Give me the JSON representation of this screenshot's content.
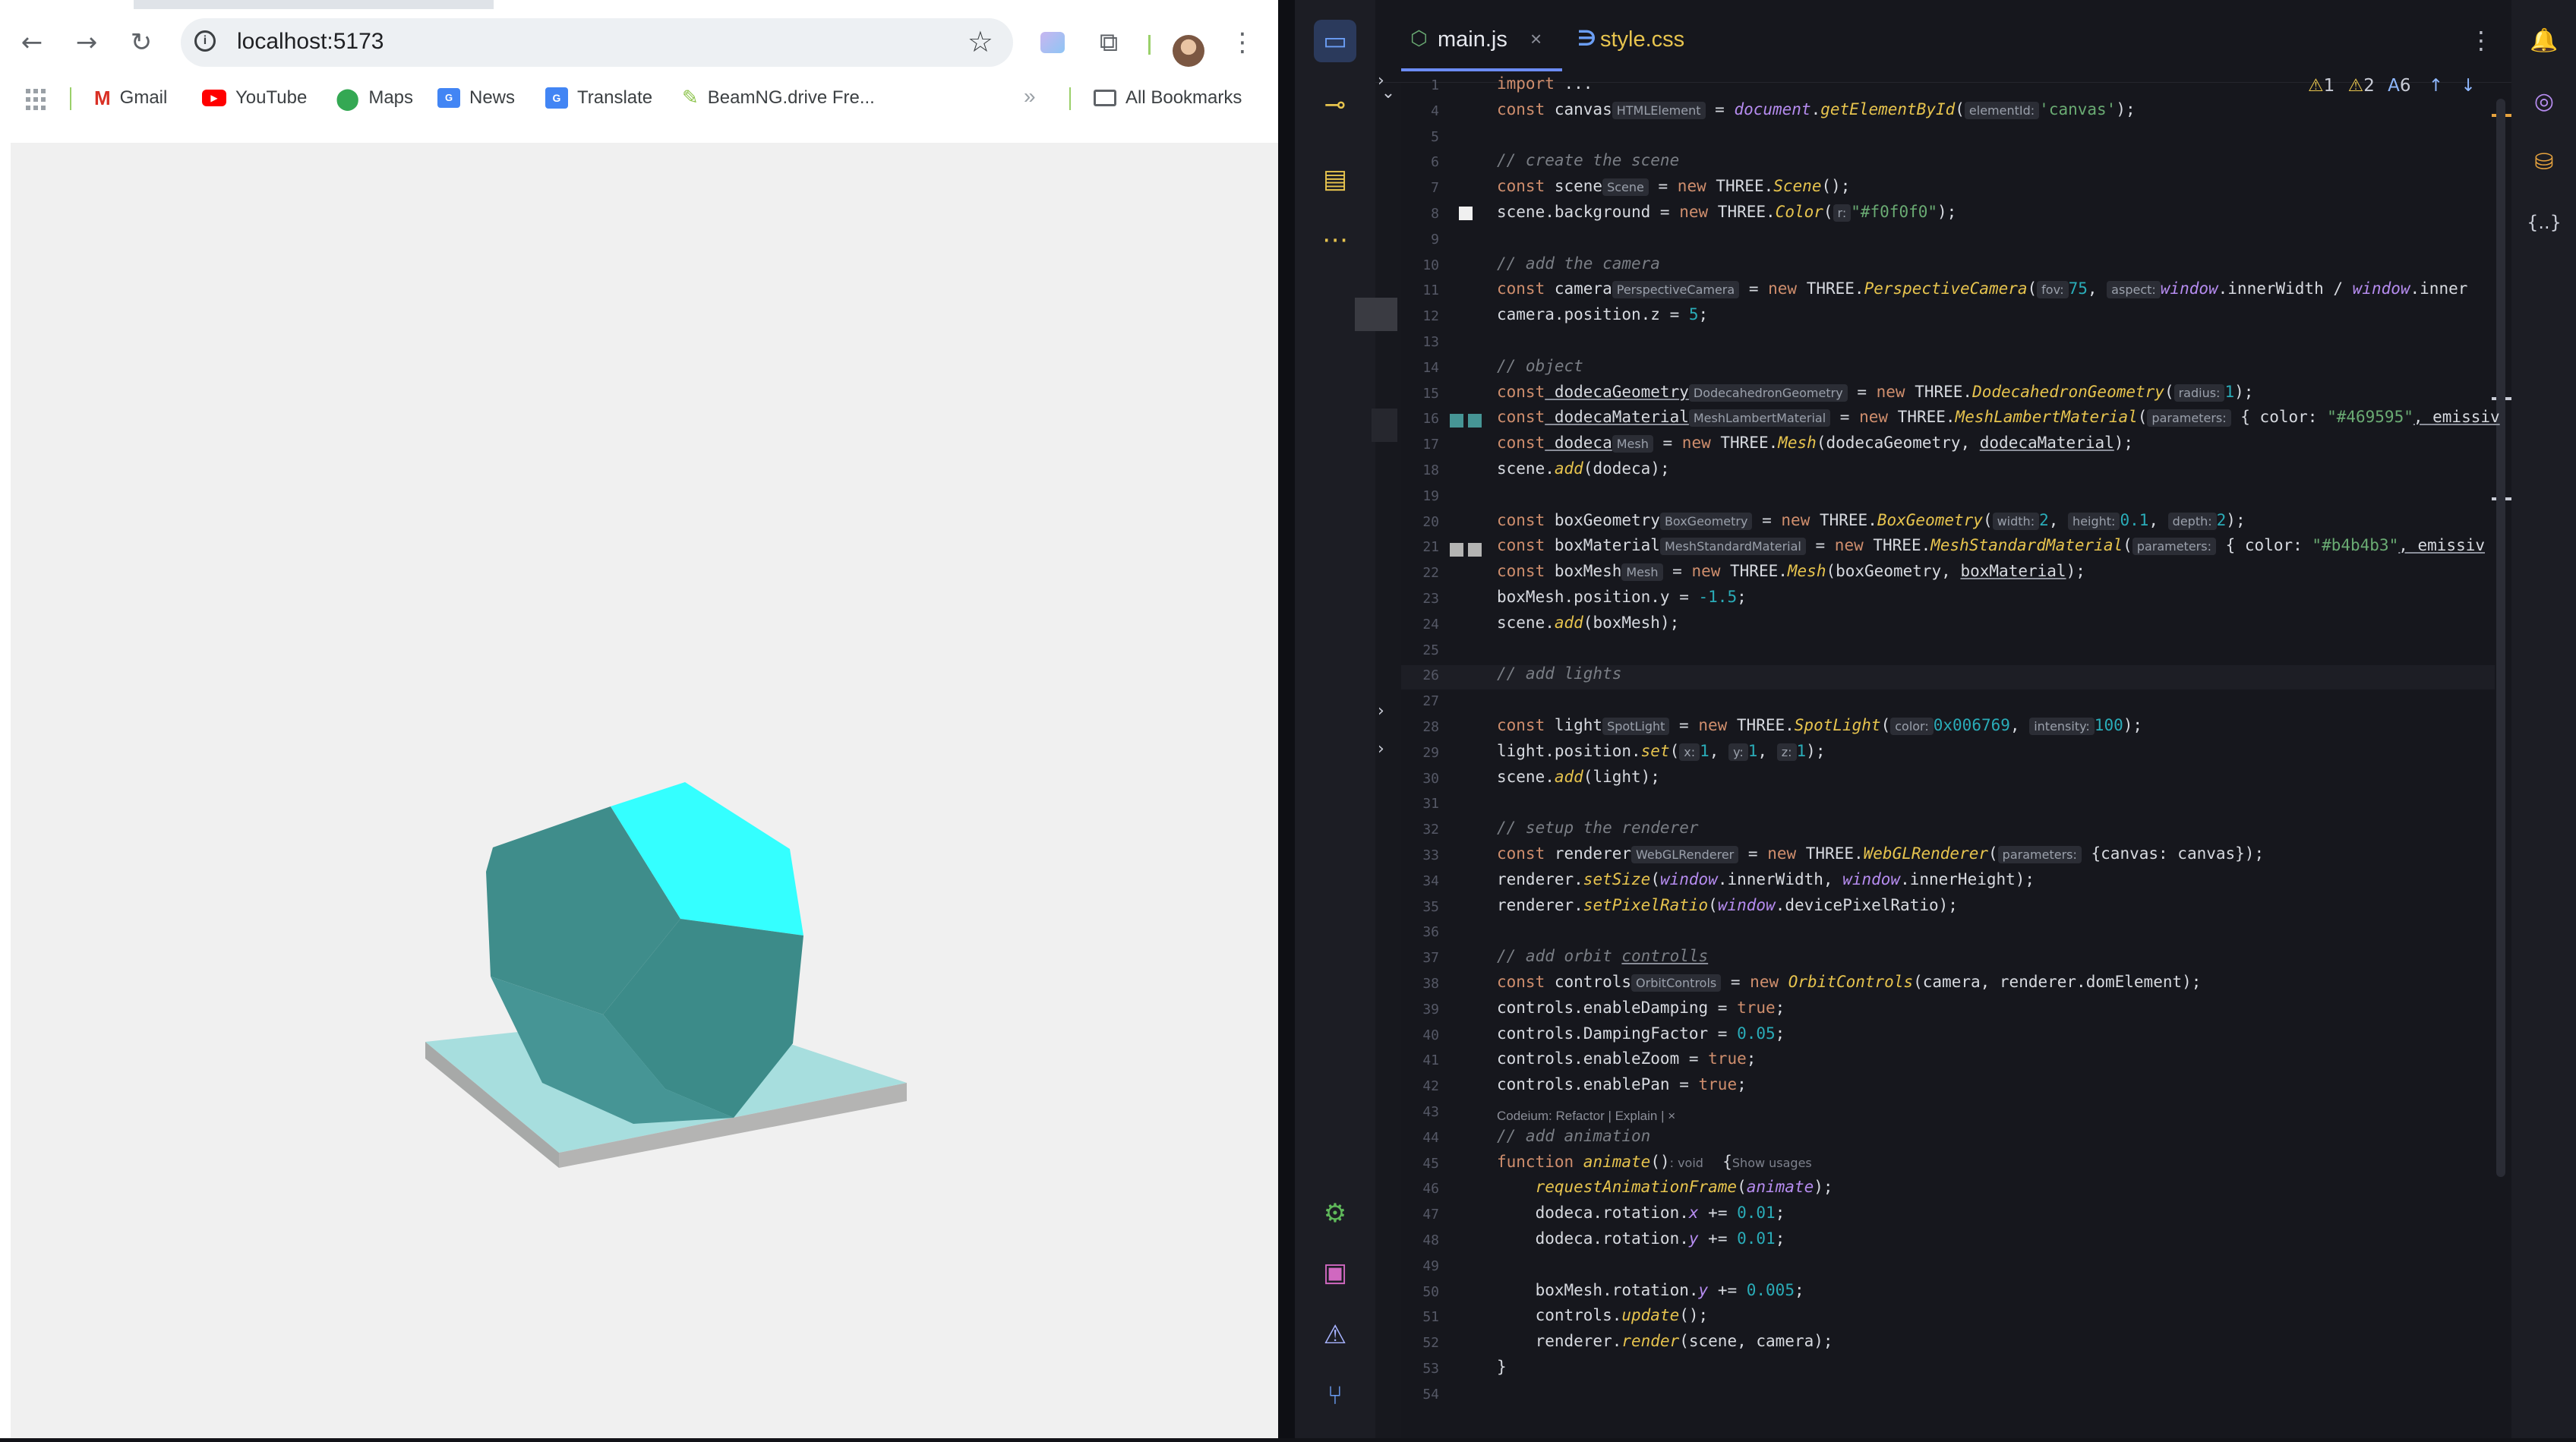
{
  "browser": {
    "url": "localhost:5173",
    "nav": {
      "back_icon": "back-arrow-icon",
      "forward_icon": "forward-arrow-icon",
      "reload_icon": "reload-icon"
    },
    "bookmarks": [
      {
        "label": "Gmail",
        "icon": "gmail-icon"
      },
      {
        "label": "YouTube",
        "icon": "youtube-icon"
      },
      {
        "label": "Maps",
        "icon": "maps-icon"
      },
      {
        "label": "News",
        "icon": "news-icon"
      },
      {
        "label": "Translate",
        "icon": "translate-icon"
      },
      {
        "label": "BeamNG.drive Fre...",
        "icon": "beamng-icon"
      }
    ],
    "all_bookmarks": "All Bookmarks",
    "more": "»",
    "scene": {
      "background": "#f0f0f0",
      "dodeca_color": "#469595",
      "box_color": "#b4b4b3"
    }
  },
  "ide": {
    "tabs": [
      {
        "label": "main.js",
        "active": true,
        "close": "×"
      },
      {
        "label": "style.css",
        "active": false
      }
    ],
    "inspections": {
      "warn1": "1",
      "warn2": "2",
      "typo": "6"
    },
    "codeium_lens": "Codeium: Refactor | Explain | ×",
    "lines": [
      {
        "n": "1"
      },
      {
        "n": "4"
      },
      {
        "n": "5"
      },
      {
        "n": "6"
      },
      {
        "n": "7"
      },
      {
        "n": "8"
      },
      {
        "n": "9"
      },
      {
        "n": "10"
      },
      {
        "n": "11"
      },
      {
        "n": "12"
      },
      {
        "n": "13"
      },
      {
        "n": "14"
      },
      {
        "n": "15"
      },
      {
        "n": "16"
      },
      {
        "n": "17"
      },
      {
        "n": "18"
      },
      {
        "n": "19"
      },
      {
        "n": "20"
      },
      {
        "n": "21"
      },
      {
        "n": "22"
      },
      {
        "n": "23"
      },
      {
        "n": "24"
      },
      {
        "n": "25"
      },
      {
        "n": "26"
      },
      {
        "n": "27"
      },
      {
        "n": "28"
      },
      {
        "n": "29"
      },
      {
        "n": "30"
      },
      {
        "n": "31"
      },
      {
        "n": "32"
      },
      {
        "n": "33"
      },
      {
        "n": "34"
      },
      {
        "n": "35"
      },
      {
        "n": "36"
      },
      {
        "n": "37"
      },
      {
        "n": "38"
      },
      {
        "n": "39"
      },
      {
        "n": "40"
      },
      {
        "n": "41"
      },
      {
        "n": "42"
      },
      {
        "n": "43"
      },
      {
        "n": "44"
      },
      {
        "n": "45"
      },
      {
        "n": "46"
      },
      {
        "n": "47"
      },
      {
        "n": "48"
      },
      {
        "n": "49"
      },
      {
        "n": "50"
      },
      {
        "n": "51"
      },
      {
        "n": "52"
      },
      {
        "n": "53"
      },
      {
        "n": "54"
      }
    ],
    "code": {
      "l1": {
        "kw": "import",
        "rest": " ..."
      },
      "l4": {
        "kw": "const",
        "v": " canvas",
        "hint": "HTMLElement",
        "eq": " = ",
        "obj": "document",
        "dot": ".",
        "fn": "getElementById",
        "op": "(",
        "ph": "elementId:",
        "str": "'canvas'",
        "end": ");"
      },
      "l6": "// create the scene",
      "l7": {
        "kw": "const",
        "v": " scene",
        "hint": "Scene",
        "eq": " = ",
        "kw2": "new",
        "cls": " THREE.",
        "fn": "Scene",
        "end": "();"
      },
      "l8": {
        "a": "scene.background = ",
        "kw2": "new",
        "cls": " THREE.",
        "fn": "Color",
        "op": "(",
        "ph": "r:",
        "str": "\"#f0f0f0\"",
        "end": ");"
      },
      "l10": "// add the camera",
      "l11": {
        "kw": "const",
        "v": " camera",
        "hint": "PerspectiveCamera",
        "eq": " = ",
        "kw2": "new",
        "cls": " THREE.",
        "fn": "PerspectiveCamera",
        "op": "(",
        "ph1": "fov:",
        "n1": "75",
        "c1": ", ",
        "ph2": "aspect:",
        "w1": "window",
        "r1": ".innerWidth / ",
        "w2": "window",
        "r2": ".inner"
      },
      "l12": {
        "a": "camera.position.z = ",
        "n": "5",
        "end": ";"
      },
      "l14": "// object",
      "l15": {
        "kw": "const",
        "v": " dodecaGeometry",
        "hint": "DodecahedronGeometry",
        "eq": " = ",
        "kw2": "new",
        "cls": " THREE.",
        "fn": "DodecahedronGeometry",
        "op": "(",
        "ph": "radius:",
        "n": "1",
        "end": ");"
      },
      "l16": {
        "kw": "const",
        "v": " dodecaMaterial",
        "hint": "MeshLambertMaterial",
        "eq": " = ",
        "kw2": "new",
        "cls": " THREE.",
        "fn": "MeshLambertMaterial",
        "op": "(",
        "ph": "parameters:",
        "r": " { color: ",
        "str": "\"#469595\"",
        "tail": ", emissiv"
      },
      "l17": {
        "kw": "const",
        "v": " dodeca",
        "hint": "Mesh",
        "eq": " = ",
        "kw2": "new",
        "cls": " THREE.",
        "fn": "Mesh",
        "r": "(dodecaGeometry, ",
        "u": "dodecaMaterial",
        "end": ");"
      },
      "l18": {
        "a": "scene.",
        "fn": "add",
        "end": "(dodeca);"
      },
      "l20": {
        "kw": "const",
        "v": " boxGeometry",
        "hint": "BoxGeometry",
        "eq": " = ",
        "kw2": "new",
        "cls": " THREE.",
        "fn": "BoxGeometry",
        "op": "(",
        "ph1": "width:",
        "n1": "2",
        "c1": ", ",
        "ph2": "height:",
        "n2": "0.1",
        "c2": ", ",
        "ph3": "depth:",
        "n3": "2",
        "end": ");"
      },
      "l21": {
        "kw": "const",
        "v": " boxMaterial",
        "hint": "MeshStandardMaterial",
        "eq": " = ",
        "kw2": "new",
        "cls": " THREE.",
        "fn": "MeshStandardMaterial",
        "op": "(",
        "ph": "parameters:",
        "r": " { color: ",
        "str": "\"#b4b4b3\"",
        "tail": ", emissiv"
      },
      "l22": {
        "kw": "const",
        "v": " boxMesh",
        "hint": "Mesh",
        "eq": " = ",
        "kw2": "new",
        "cls": " THREE.",
        "fn": "Mesh",
        "r": "(boxGeometry, ",
        "u": "boxMaterial",
        "end": ");"
      },
      "l23": {
        "a": "boxMesh.position.y = ",
        "n": "-1.5",
        "end": ";"
      },
      "l24": {
        "a": "scene.",
        "fn": "add",
        "end": "(boxMesh);"
      },
      "l26": "// add lights",
      "l28": {
        "kw": "const",
        "v": " light",
        "hint": "SpotLight",
        "eq": " = ",
        "kw2": "new",
        "cls": " THREE.",
        "fn": "SpotLight",
        "op": "(",
        "ph1": "color:",
        "n1": "0x006769",
        "c1": ", ",
        "ph2": "intensity:",
        "n2": "100",
        "end": ");"
      },
      "l29": {
        "a": "light.position.",
        "fn": "set",
        "op": "(",
        "ph1": "x:",
        "n1": "1",
        "c1": ", ",
        "ph2": "y:",
        "n2": "1",
        "c2": ", ",
        "ph3": "z:",
        "n3": "1",
        "end": ");"
      },
      "l30": {
        "a": "scene.",
        "fn": "add",
        "end": "(light);"
      },
      "l32": "// setup the renderer",
      "l33": {
        "kw": "const",
        "v": " renderer",
        "hint": "WebGLRenderer",
        "eq": " = ",
        "kw2": "new",
        "cls": " THREE.",
        "fn": "WebGLRenderer",
        "op": "(",
        "ph": "parameters:",
        "r": " {canvas: canvas});"
      },
      "l34": {
        "a": "renderer.",
        "fn": "setSize",
        "op": "(",
        "w1": "window",
        "r1": ".innerWidth, ",
        "w2": "window",
        "r2": ".innerHeight);"
      },
      "l35": {
        "a": "renderer.",
        "fn": "setPixelRatio",
        "op": "(",
        "w1": "window",
        "r1": ".devicePixelRatio);"
      },
      "l37": {
        "c": "// add orbit ",
        "u": "controlls"
      },
      "l38": {
        "kw": "const",
        "v": " controls",
        "hint": "OrbitControls",
        "eq": " = ",
        "kw2": "new",
        "fn": " OrbitControls",
        "r": "(camera, renderer.domElement);"
      },
      "l39": {
        "a": "controls.enableDamping = ",
        "kw": "true",
        "end": ";"
      },
      "l40": {
        "a": "controls.DampingFactor = ",
        "n": "0.05",
        "end": ";"
      },
      "l41": {
        "a": "controls.enableZoom = ",
        "kw": "true",
        "end": ";"
      },
      "l42": {
        "a": "controls.enablePan = ",
        "kw": "true",
        "end": ";"
      },
      "l44": "// add animation",
      "l45": {
        "kw": "function",
        "fn": " animate",
        "r": "()",
        "hint": ": void",
        "b": "  {",
        "usages": "Show usages"
      },
      "l46": {
        "fn": "    requestAnimationFrame",
        "op": "(",
        "p": "animate",
        "end": ");"
      },
      "l47": {
        "a": "    dodeca.rotation.",
        "p": "x",
        "r": " += ",
        "n": "0.01",
        "end": ";"
      },
      "l48": {
        "a": "    dodeca.rotation.",
        "p": "y",
        "r": " += ",
        "n": "0.01",
        "end": ";"
      },
      "l50": {
        "a": "    boxMesh.rotation.",
        "p": "y",
        "r": " += ",
        "n": "0.005",
        "end": ";"
      },
      "l51": {
        "a": "    controls.",
        "fn": "update",
        "end": "();"
      },
      "l52": {
        "a": "    renderer.",
        "fn": "render",
        "end": "(scene, camera);"
      },
      "l53": "}"
    }
  }
}
